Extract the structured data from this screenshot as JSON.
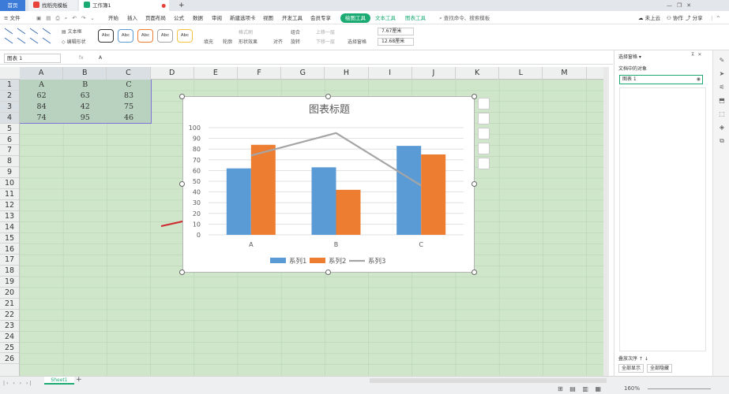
{
  "tabs": {
    "home": "首页",
    "template": "找稻壳模板",
    "workbook": "工作簿1",
    "new_tab": "+"
  },
  "ribbon": {
    "file": "文件",
    "tabs": [
      "开始",
      "插入",
      "页面布局",
      "公式",
      "数据",
      "审阅",
      "视图",
      "新建选项卡",
      "开发工具",
      "会员专享",
      "绘图工具",
      "文本工具",
      "图表工具"
    ],
    "search": "查找命令、搜索模板",
    "cloud": "未上云",
    "collab": "协作",
    "share": "分享"
  },
  "toolbar": {
    "textbox": "文本框",
    "edit_shape": "编辑形状",
    "style_label": "Abc",
    "fill": "填充",
    "outline": "轮廓",
    "format_painter": "格式刷",
    "shape_effect": "形状效果",
    "align": "对齐",
    "group": "组合",
    "rotate": "旋转",
    "bring_forward": "上移一层",
    "send_backward": "下移一层",
    "selection_pane": "选择窗格",
    "height": "7.67厘米",
    "width": "12.68厘米"
  },
  "formula": {
    "namebox": "图表 1",
    "fx": "fx",
    "value": "A"
  },
  "columns": [
    "A",
    "B",
    "C",
    "D",
    "E",
    "F",
    "G",
    "H",
    "I",
    "J",
    "K",
    "L",
    "M"
  ],
  "rows": [
    "1",
    "2",
    "3",
    "4",
    "5",
    "6",
    "7",
    "8",
    "9",
    "10",
    "11",
    "12",
    "13",
    "14",
    "15",
    "16",
    "17",
    "18",
    "19",
    "20",
    "21",
    "22",
    "23",
    "24",
    "25",
    "26"
  ],
  "cells": [
    [
      "A",
      "B",
      "C"
    ],
    [
      "62",
      "63",
      "83"
    ],
    [
      "84",
      "42",
      "75"
    ],
    [
      "74",
      "95",
      "46"
    ]
  ],
  "chart_data": {
    "type": "bar",
    "title": "图表标题",
    "categories": [
      "A",
      "B",
      "C"
    ],
    "series": [
      {
        "name": "系列1",
        "type": "bar",
        "values": [
          62,
          63,
          83
        ],
        "color": "#5b9bd5"
      },
      {
        "name": "系列2",
        "type": "bar",
        "values": [
          84,
          42,
          75
        ],
        "color": "#ed7d31"
      },
      {
        "name": "系列3",
        "type": "line",
        "values": [
          74,
          95,
          46
        ],
        "color": "#a5a5a5"
      }
    ],
    "yticks": [
      "0",
      "10",
      "20",
      "30",
      "40",
      "50",
      "60",
      "70",
      "80",
      "90",
      "100"
    ],
    "ylim": [
      0,
      100
    ],
    "grid": true,
    "legend": "bottom"
  },
  "panel": {
    "title": "选择窗格",
    "subtitle": "文档中的对象",
    "object": "图表 1",
    "order_label": "叠放次序",
    "show_all": "全部显示",
    "hide_all": "全部隐藏"
  },
  "status": {
    "sheet": "Sheet1",
    "zoom": "160%"
  },
  "colors": {
    "accent": "#1bab72",
    "selection": "#7e74d8",
    "annotation_arrow": "#d0282e"
  }
}
